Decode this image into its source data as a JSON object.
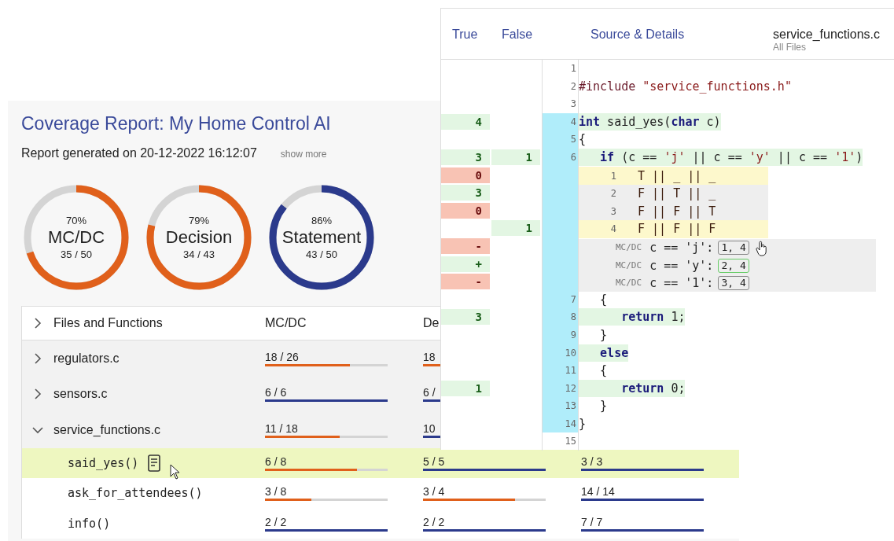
{
  "report": {
    "title": "Coverage Report: My Home Control AI",
    "generated": "Report generated on 20-12-2022 16:12:07",
    "show_more": "show more",
    "gauges": [
      {
        "percent": "70%",
        "label": "MC/DC",
        "ratio": "35 / 50",
        "level": 0.7,
        "color": "#e0601b"
      },
      {
        "percent": "79%",
        "label": "Decision",
        "ratio": "34 / 43",
        "level": 0.79,
        "color": "#e0601b"
      },
      {
        "percent": "86%",
        "label": "Statement",
        "ratio": "43 / 50",
        "level": 0.86,
        "color": "#2b3a8c"
      }
    ],
    "table": {
      "name_column": "Files and Functions",
      "columns": [
        "MC/DC",
        "De"
      ],
      "rows": [
        {
          "name": "regulators.c",
          "expanded": false,
          "cells": [
            {
              "text": "18 / 26",
              "level": 0.69
            },
            {
              "text": "18",
              "level": 0.8
            }
          ],
          "children": []
        },
        {
          "name": "sensors.c",
          "expanded": false,
          "cells": [
            {
              "text": "6 / 6",
              "level": 1
            },
            {
              "text": "6 /",
              "level": 1
            }
          ],
          "children": []
        },
        {
          "name": "service_functions.c",
          "expanded": true,
          "cells": [
            {
              "text": "11 / 18",
              "level": 0.61
            },
            {
              "text": "10",
              "level": 1
            }
          ],
          "children": [
            {
              "name": "said_yes()",
              "selected": true,
              "cells": [
                {
                  "text": "6 / 8",
                  "level": 0.75
                },
                {
                  "text": "5 / 5",
                  "level": 1
                },
                {
                  "text": "3 / 3",
                  "level": 1
                }
              ]
            },
            {
              "name": "ask_for_attendees()",
              "selected": false,
              "cells": [
                {
                  "text": "3 / 8",
                  "level": 0.375
                },
                {
                  "text": "3 / 4",
                  "level": 0.75
                },
                {
                  "text": "14 / 14",
                  "level": 1
                }
              ]
            },
            {
              "name": "info()",
              "selected": false,
              "cells": [
                {
                  "text": "2 / 2",
                  "level": 1
                },
                {
                  "text": "2 / 2",
                  "level": 1
                },
                {
                  "text": "7 / 7",
                  "level": 1
                }
              ]
            }
          ]
        }
      ]
    }
  },
  "source": {
    "columns": [
      "True",
      "False",
      "Source & Details"
    ],
    "file": "service_functions.c",
    "scope": "All Files",
    "rows": [
      {
        "kind": "line",
        "number": "1",
        "in_function": false
      },
      {
        "kind": "line",
        "number": "2",
        "in_function": false,
        "covered": false,
        "tokens": [
          {
            "text": "#include ",
            "kind": "preprocessor"
          },
          {
            "text": "\"service_functions.h\"",
            "kind": "string"
          }
        ]
      },
      {
        "kind": "line",
        "number": "3",
        "in_function": false
      },
      {
        "kind": "line",
        "number": "4",
        "in_function": true,
        "covered": true,
        "true_count": {
          "text": "4",
          "covered": true
        },
        "tokens": [
          {
            "text": "int",
            "kind": "keyword"
          },
          {
            "text": " said_yes(",
            "kind": "plain"
          },
          {
            "text": "char",
            "kind": "keyword"
          },
          {
            "text": " c)",
            "kind": "plain"
          }
        ]
      },
      {
        "kind": "line",
        "number": "5",
        "in_function": true,
        "covered": false,
        "tokens": [
          {
            "text": "{",
            "kind": "plain"
          }
        ]
      },
      {
        "kind": "line",
        "number": "6",
        "in_function": true,
        "covered": true,
        "true_count": {
          "text": "3",
          "covered": true
        },
        "false_count": {
          "text": "1",
          "covered": true
        },
        "tokens": [
          {
            "text": "   if",
            "kind": "keyword"
          },
          {
            "text": " (c == ",
            "kind": "plain"
          },
          {
            "text": "'j'",
            "kind": "string"
          },
          {
            "text": " || c == ",
            "kind": "plain"
          },
          {
            "text": "'y'",
            "kind": "string"
          },
          {
            "text": " || c == ",
            "kind": "plain"
          },
          {
            "text": "'1'",
            "kind": "string"
          },
          {
            "text": ")",
            "kind": "plain"
          }
        ]
      },
      {
        "kind": "condition",
        "number": "1",
        "text": "T || _ || _",
        "selected": true,
        "true_count": {
          "text": "0",
          "covered": false
        }
      },
      {
        "kind": "condition",
        "number": "2",
        "text": "F || T || _",
        "selected": false,
        "true_count": {
          "text": "3",
          "covered": true
        }
      },
      {
        "kind": "condition",
        "number": "3",
        "text": "F || F || T",
        "selected": false,
        "true_count": {
          "text": "0",
          "covered": false
        }
      },
      {
        "kind": "condition",
        "number": "4",
        "text": "F || F || F",
        "selected": true,
        "false_count": {
          "text": "1",
          "covered": true
        }
      },
      {
        "kind": "mcdc",
        "label": "MC/DC",
        "expr": "c == 'j':",
        "pair": "1, 4",
        "covered": false,
        "true_count": {
          "text": "-",
          "covered": false
        }
      },
      {
        "kind": "mcdc",
        "label": "MC/DC",
        "expr": "c == 'y':",
        "pair": "2, 4",
        "covered": true,
        "true_count": {
          "text": "+",
          "covered": true
        }
      },
      {
        "kind": "mcdc",
        "label": "MC/DC",
        "expr": "c == '1':",
        "pair": "3, 4",
        "covered": false,
        "true_count": {
          "text": "-",
          "covered": false
        }
      },
      {
        "kind": "line",
        "number": "7",
        "in_function": true,
        "covered": false,
        "tokens": [
          {
            "text": "   {",
            "kind": "plain"
          }
        ]
      },
      {
        "kind": "line",
        "number": "8",
        "in_function": true,
        "covered": true,
        "true_count": {
          "text": "3",
          "covered": true
        },
        "tokens": [
          {
            "text": "      return",
            "kind": "keyword"
          },
          {
            "text": " 1;",
            "kind": "plain"
          }
        ]
      },
      {
        "kind": "line",
        "number": "9",
        "in_function": true,
        "covered": false,
        "tokens": [
          {
            "text": "   }",
            "kind": "plain"
          }
        ]
      },
      {
        "kind": "line",
        "number": "10",
        "in_function": true,
        "covered": true,
        "tokens": [
          {
            "text": "   else",
            "kind": "keyword"
          }
        ]
      },
      {
        "kind": "line",
        "number": "11",
        "in_function": true,
        "covered": false,
        "tokens": [
          {
            "text": "   {",
            "kind": "plain"
          }
        ]
      },
      {
        "kind": "line",
        "number": "12",
        "in_function": true,
        "covered": true,
        "true_count": {
          "text": "1",
          "covered": true
        },
        "tokens": [
          {
            "text": "      return",
            "kind": "keyword"
          },
          {
            "text": " 0;",
            "kind": "plain"
          }
        ]
      },
      {
        "kind": "line",
        "number": "13",
        "in_function": true,
        "covered": false,
        "tokens": [
          {
            "text": "   }",
            "kind": "plain"
          }
        ]
      },
      {
        "kind": "line",
        "number": "14",
        "in_function": true,
        "covered": false,
        "tokens": [
          {
            "text": "}",
            "kind": "plain"
          }
        ]
      },
      {
        "kind": "line",
        "number": "15",
        "in_function": false
      }
    ]
  }
}
